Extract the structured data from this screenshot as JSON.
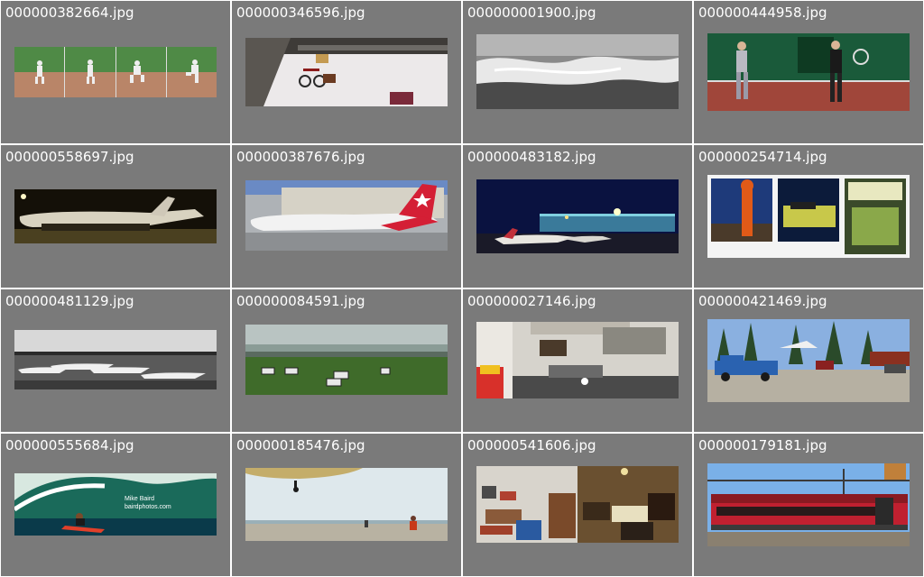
{
  "grid": {
    "tiles": [
      {
        "filename": "000000382664.jpg",
        "thumbnail": "baseball-pitcher-sequence"
      },
      {
        "filename": "000000346596.jpg",
        "thumbnail": "snowy-street-bicycle"
      },
      {
        "filename": "000000001900.jpg",
        "thumbnail": "ocean-wave-grayscale"
      },
      {
        "filename": "000000444958.jpg",
        "thumbnail": "children-tennis-court"
      },
      {
        "filename": "000000558697.jpg",
        "thumbnail": "airliner-night"
      },
      {
        "filename": "000000387676.jpg",
        "thumbnail": "red-tail-airliner"
      },
      {
        "filename": "000000483182.jpg",
        "thumbnail": "airport-night"
      },
      {
        "filename": "000000254714.jpg",
        "thumbnail": "hydrant-store-triptych"
      },
      {
        "filename": "000000481129.jpg",
        "thumbnail": "airport-grayscale"
      },
      {
        "filename": "000000084591.jpg",
        "thumbnail": "zebras-grassland"
      },
      {
        "filename": "000000027146.jpg",
        "thumbnail": "kitchen-interior"
      },
      {
        "filename": "000000421469.jpg",
        "thumbnail": "blue-pickup-truck"
      },
      {
        "filename": "000000555684.jpg",
        "thumbnail": "surfer-wave"
      },
      {
        "filename": "000000185476.jpg",
        "thumbnail": "beach-kite"
      },
      {
        "filename": "000000541606.jpg",
        "thumbnail": "living-room-pair"
      },
      {
        "filename": "000000179181.jpg",
        "thumbnail": "red-train-station"
      }
    ],
    "watermark": [
      "Mike Baird",
      "bairdphotos.com"
    ]
  }
}
